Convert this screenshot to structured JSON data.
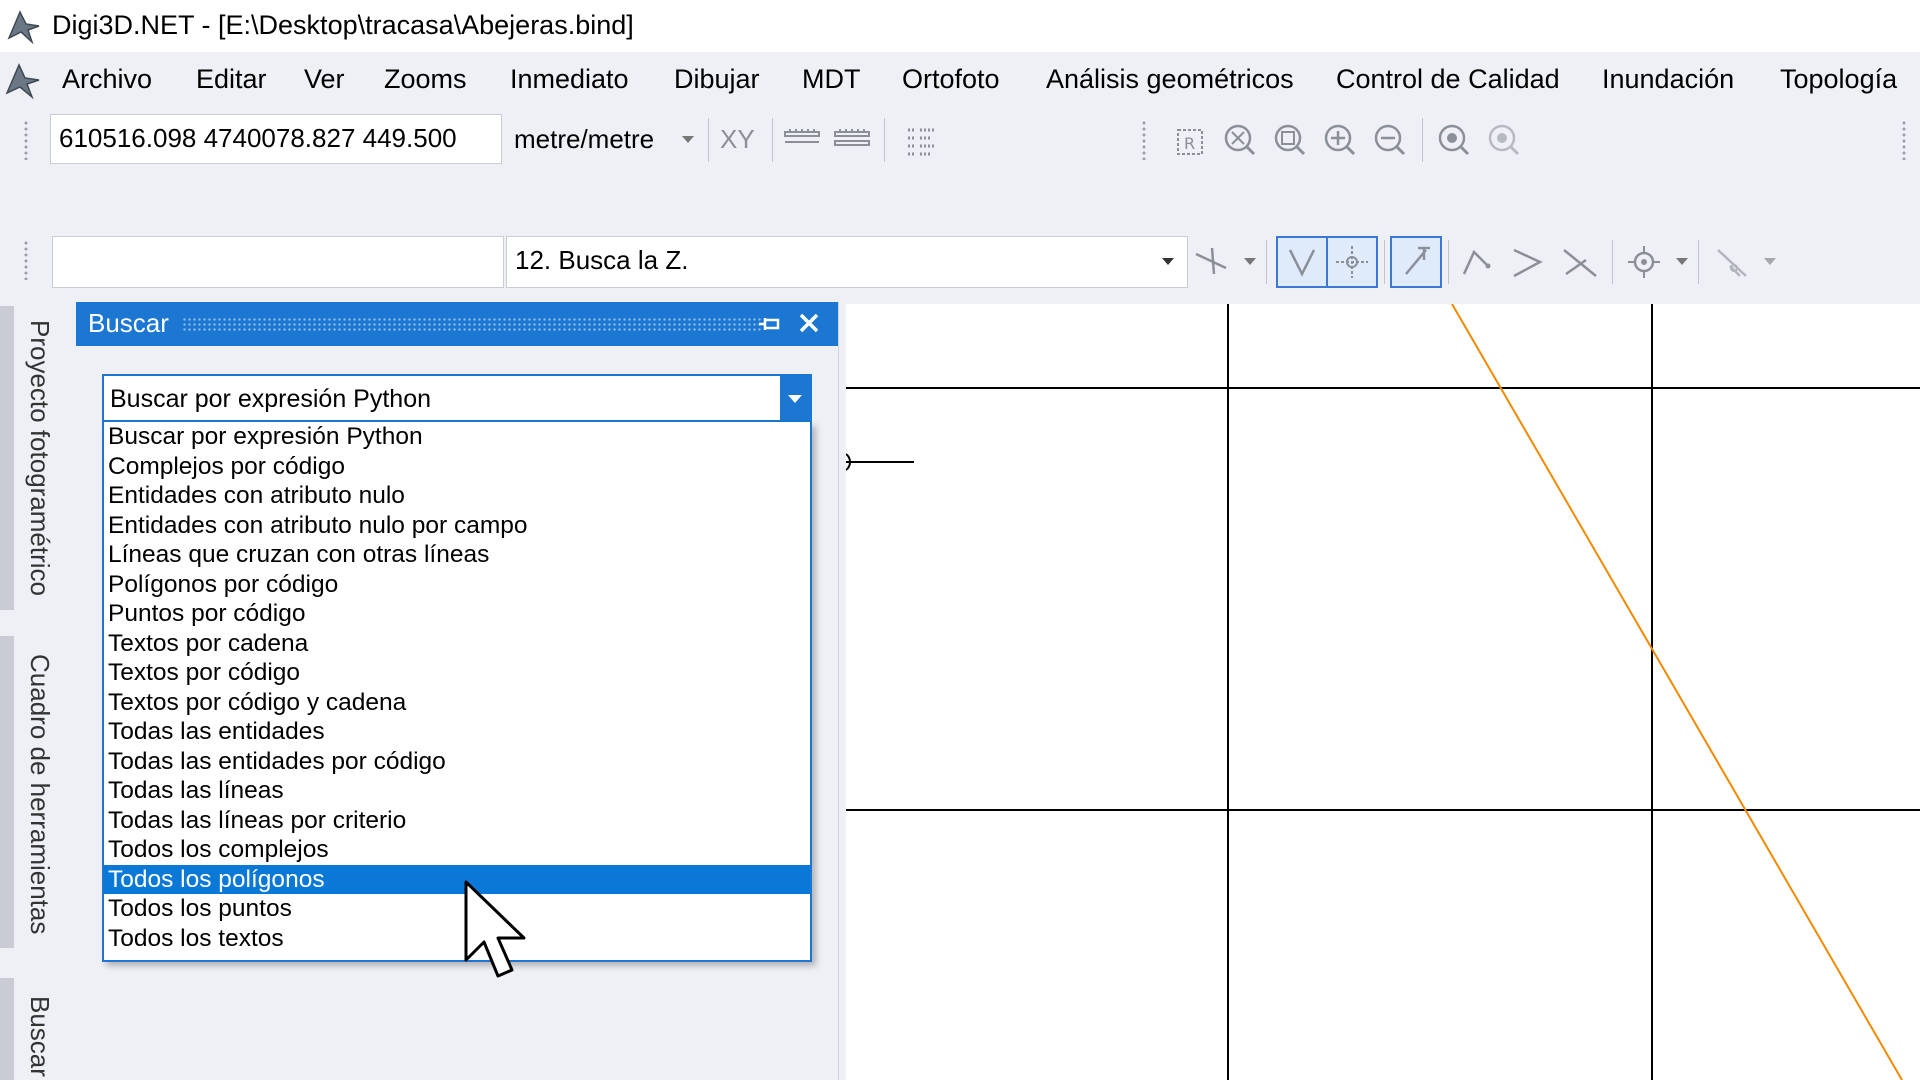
{
  "window": {
    "title": "Digi3D.NET - [E:\\Desktop\\tracasa\\Abejeras.bind]",
    "app_icon": "digi3d-logo-icon"
  },
  "menu": {
    "items": [
      "Archivo",
      "Editar",
      "Ver",
      "Zooms",
      "Inmediato",
      "Dibujar",
      "MDT",
      "Ortofoto",
      "Análisis geométricos",
      "Control de Calidad",
      "Inundación",
      "Topología"
    ]
  },
  "toolbar1": {
    "coordinates": "610516.098 4740078.827 449.500",
    "units": "metre/metre",
    "xy_label": "XY",
    "icons": [
      "ruler-horizontal-icon",
      "ruler-double-icon",
      "list-icon",
      "zoom-region-icon",
      "zoom-extents-icon",
      "zoom-window-icon",
      "zoom-in-icon",
      "zoom-out-icon",
      "zoom-previous-icon",
      "zoom-next-icon"
    ]
  },
  "toolbar2": {
    "command_input": "",
    "command_select": "12. Busca la Z.",
    "icons": [
      "snap-icon",
      "vertex-snap-icon",
      "center-snap-icon",
      "perpendicular-snap-icon",
      "polyline-icon",
      "angle-icon",
      "intersection-icon",
      "target-icon",
      "disabled-snap-icon"
    ]
  },
  "left_tabs": [
    "Proyecto fotogramétrico",
    "Cuadro de herramientas",
    "Buscar"
  ],
  "buscar_panel": {
    "title": "Buscar",
    "combo_value": "Buscar por expresión Python",
    "options": [
      "Buscar por expresión Python",
      "Complejos por código",
      "Entidades con atributo nulo",
      "Entidades con atributo nulo por campo",
      "Líneas que cruzan con otras líneas",
      "Polígonos por código",
      "Puntos por código",
      "Textos por cadena",
      "Textos por código",
      "Textos por código y cadena",
      "Todas las entidades",
      "Todas las entidades por código",
      "Todas las líneas",
      "Todas las líneas por criterio",
      "Todos los complejos",
      "Todos los polígonos",
      "Todos los puntos",
      "Todos los textos"
    ],
    "selected_option": "Todos los polígonos"
  },
  "colors": {
    "accent": "#1c77d2",
    "selection": "#0a78d7",
    "drawing_line": "#f08a00"
  }
}
